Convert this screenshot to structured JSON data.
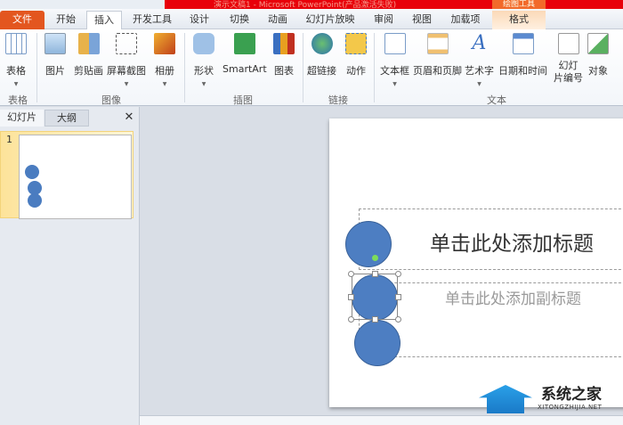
{
  "window": {
    "title": "演示文稿1 - Microsoft PowerPoint(产品激活失败)",
    "context_tab": "绘图工具"
  },
  "tabs": [
    "文件",
    "开始",
    "插入",
    "开发工具",
    "设计",
    "切换",
    "动画",
    "幻灯片放映",
    "审阅",
    "视图",
    "加载项",
    "格式"
  ],
  "active_tab": "插入",
  "ribbon": {
    "buttons": [
      "表格",
      "图片",
      "剪贴画",
      "屏幕截图",
      "相册",
      "形状",
      "SmartArt",
      "图表",
      "超链接",
      "动作",
      "文本框",
      "页眉和页脚",
      "艺术字",
      "日期和时间",
      "幻灯\n片编号",
      "对象"
    ],
    "groups": [
      "表格",
      "图像",
      "插图",
      "链接",
      "文本"
    ]
  },
  "panel": {
    "tabs": [
      "幻灯片",
      "大纲"
    ],
    "close": "✕",
    "slide_number": "1"
  },
  "slide": {
    "title_placeholder": "单击此处添加标题",
    "subtitle_placeholder": "单击此处添加副标题"
  },
  "watermark": {
    "name": "系统之家",
    "url": "XITONGZHIJIA.NET"
  }
}
